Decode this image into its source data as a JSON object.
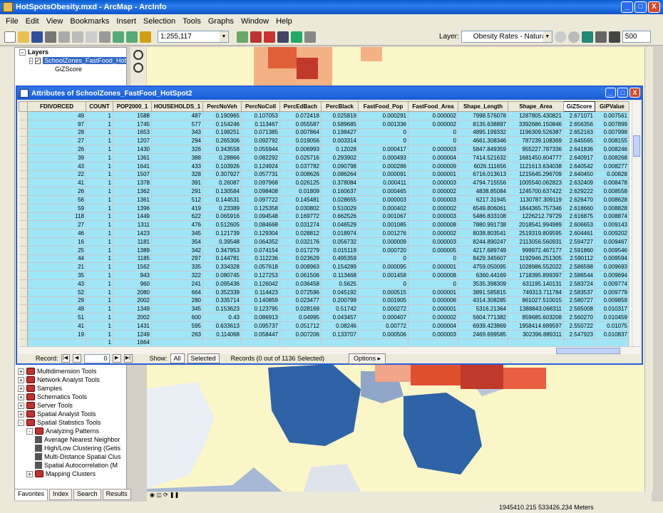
{
  "window": {
    "title": "HotSpotsObesity.mxd - ArcMap - ArcInfo",
    "min": "_",
    "max": "□",
    "close": "X"
  },
  "menu": [
    "File",
    "Edit",
    "View",
    "Bookmarks",
    "Insert",
    "Selection",
    "Tools",
    "Graphs",
    "Window",
    "Help"
  ],
  "toolbar": {
    "scale": "1:255,117",
    "layer_label": "Layer:",
    "layer_value": "Obesity Rates - Natural Breaks",
    "number": "500"
  },
  "toc": {
    "layers_title": "Layers",
    "layer_name": "SchoolZones_FastFood_HotSp",
    "field_name": "GiZScore",
    "tools": [
      {
        "label": "Multidimension Tools",
        "indent": 1,
        "kind": "toolbox"
      },
      {
        "label": "Network Analyst Tools",
        "indent": 1,
        "kind": "toolbox"
      },
      {
        "label": "Samples",
        "indent": 1,
        "kind": "toolbox"
      },
      {
        "label": "Schematics Tools",
        "indent": 1,
        "kind": "toolbox"
      },
      {
        "label": "Server Tools",
        "indent": 1,
        "kind": "toolbox"
      },
      {
        "label": "Spatial Analyst Tools",
        "indent": 1,
        "kind": "toolbox"
      },
      {
        "label": "Spatial Statistics Tools",
        "indent": 1,
        "kind": "toolbox"
      },
      {
        "label": "Analyzing Patterns",
        "indent": 2,
        "kind": "toolbox"
      },
      {
        "label": "Average Nearest Neighbor",
        "indent": 3,
        "kind": "tool"
      },
      {
        "label": "High/Low Clustering (Getis",
        "indent": 3,
        "kind": "tool"
      },
      {
        "label": "Multi-Distance Spatial Clus",
        "indent": 3,
        "kind": "tool"
      },
      {
        "label": "Spatial Autocorrelation (M",
        "indent": 3,
        "kind": "tool"
      },
      {
        "label": "Mapping Clusters",
        "indent": 2,
        "kind": "toolbox"
      }
    ],
    "tabs": [
      "Favorites",
      "Index",
      "Search",
      "Results"
    ]
  },
  "attributes": {
    "title": "Attributes of SchoolZones_FastFood_HotSpot2",
    "columns": [
      "FDIVORCED",
      "COUNT",
      "POP2000_1",
      "HOUSEHOLDS_1",
      "PercNoVeh",
      "PercNoColl",
      "PercEdBach",
      "PercBlack",
      "FastFood_Pop",
      "FastFood_Area",
      "Shape_Length",
      "Shape_Area",
      "GiZScore",
      "GiPValue"
    ],
    "rows": [
      [
        "49",
        "1",
        "1588",
        "487",
        "0.190965",
        "0.107053",
        "0.072418",
        "0.025819",
        "0.000291",
        "0.000002",
        "7998.576078",
        "1287805.430821",
        "2.671071",
        "0.007561"
      ],
      [
        "97",
        "1",
        "1745",
        "577",
        "0.154246",
        "0.113467",
        "0.055587",
        "0.589685",
        "0.001336",
        "0.000002",
        "8135.638897",
        "3392686.150846",
        "2.656356",
        "0.007899"
      ],
      [
        "28",
        "1",
        "1653",
        "343",
        "0.198251",
        "0.071385",
        "0.007864",
        "0.198427",
        "0",
        "0",
        "4895.199332",
        "1196309.526387",
        "2.652163",
        "0.007998"
      ],
      [
        "27",
        "1",
        "1207",
        "294",
        "0.265306",
        "0.092792",
        "0.019056",
        "0.003314",
        "0",
        "0",
        "4661.308346",
        "787239.108369",
        "2.645565",
        "0.008155"
      ],
      [
        "26",
        "1",
        "1430",
        "326",
        "0.343558",
        "0.055944",
        "0.006993",
        "0.12028",
        "0.000417",
        "0.000003",
        "5847.849359",
        "955227.787336",
        "2.641836",
        "0.008246"
      ],
      [
        "39",
        "1",
        "1361",
        "388",
        "0.28866",
        "0.082292",
        "0.025716",
        "0.293902",
        "0.000493",
        "0.000004",
        "7414.521632",
        "1681450.604777",
        "2.640917",
        "0.008268"
      ],
      [
        "43",
        "1",
        "1641",
        "433",
        "0.103926",
        "0.124924",
        "0.037782",
        "0.090798",
        "0.000286",
        "0.000009",
        "6026.111656",
        "1121613.634038",
        "2.640542",
        "0.008277"
      ],
      [
        "22",
        "1",
        "1507",
        "328",
        "0.307927",
        "0.057731",
        "0.008626",
        "0.086264",
        "0.000091",
        "0.000001",
        "6716.013613",
        "1215645.296709",
        "2.640450",
        "0.00828"
      ],
      [
        "41",
        "1",
        "1378",
        "391",
        "0.26087",
        "0.097968",
        "0.026125",
        "0.378084",
        "0.000411",
        "0.000003",
        "4794.715556",
        "1005540.062823",
        "2.632409",
        "0.008478"
      ],
      [
        "26",
        "1",
        "1362",
        "291",
        "0.130584",
        "0.098408",
        "0.01809",
        "0.160637",
        "0.000465",
        "0.000002",
        "4838.85084",
        "1245700.637422",
        "2.629222",
        "0.008558"
      ],
      [
        "56",
        "1",
        "1361",
        "512",
        "0.144531",
        "0.097722",
        "0.145481",
        "0.028655",
        "0.000003",
        "0.000003",
        "6217.31945",
        "1130787.309119",
        "2.626470",
        "0.008628"
      ],
      [
        "59",
        "1",
        "1396",
        "419",
        "0.23389",
        "0.125358",
        "0.030802",
        "0.510029",
        "0.000402",
        "0.000002",
        "6549.806061",
        "1844365.757346",
        "2.618660",
        "0.008828"
      ],
      [
        "118",
        "1",
        "1449",
        "622",
        "0.065916",
        "0.094548",
        "0.169772",
        "0.662526",
        "0.001067",
        "0.000003",
        "5486.833108",
        "1226212.79729",
        "2.616875",
        "0.008874"
      ],
      [
        "27",
        "1",
        "1311",
        "476",
        "0.512605",
        "0.084668",
        "0.031274",
        "0.046529",
        "0.001085",
        "0.000008",
        "7880.991738",
        "2018541.994989",
        "2.606653",
        "0.009143"
      ],
      [
        "46",
        "1",
        "1423",
        "345",
        "0.121739",
        "0.129304",
        "0.028812",
        "0.018974",
        "0.001276",
        "0.000002",
        "8038.803541",
        "2519319.809595",
        "2.604461",
        "0.009202"
      ],
      [
        "16",
        "1",
        "1181",
        "354",
        "0.39548",
        "0.064352",
        "0.032176",
        "0.056732",
        "0.000009",
        "0.000003",
        "8244.890247",
        "2113056.560931",
        "2.594727",
        "0.009467"
      ],
      [
        "25",
        "1",
        "1389",
        "342",
        "0.347953",
        "0.074154",
        "0.017279",
        "0.015119",
        "0.000720",
        "0.000005",
        "4217.689749",
        "999972.467177",
        "2.591860",
        "0.009546"
      ],
      [
        "44",
        "1",
        "1185",
        "297",
        "0.144781",
        "0.112236",
        "0.023629",
        "0.495359",
        "0",
        "0",
        "8429.345607",
        "1192946.251305",
        "2.590112",
        "0.009594"
      ],
      [
        "21",
        "1",
        "1562",
        "335",
        "0.334328",
        "0.057618",
        "0.008963",
        "0.154289",
        "0.000095",
        "0.000001",
        "4759.050095",
        "1028986.552022",
        "2.586598",
        "0.009693"
      ],
      [
        "35",
        "1",
        "943",
        "322",
        "0.080745",
        "0.127253",
        "0.061506",
        "0.113468",
        "0.001458",
        "0.000008",
        "6360.44169",
        "1718395.899397",
        "2.586544",
        "0.009694"
      ],
      [
        "43",
        "1",
        "960",
        "241",
        "0.095436",
        "0.126042",
        "0.036458",
        "0.5625",
        "0",
        "0",
        "3535.398309",
        "631195.140131",
        "2.583724",
        "0.009774"
      ],
      [
        "52",
        "1",
        "2080",
        "664",
        "0.352339",
        "0.114423",
        "0.072596",
        "0.045192",
        "0.000515",
        "0.000001",
        "3891.585815",
        "749313.711784",
        "2.583537",
        "0.009779"
      ],
      [
        "29",
        "1",
        "2002",
        "280",
        "0.335714",
        "0.140859",
        "0.023477",
        "0.200799",
        "0.001905",
        "0.000006",
        "4314.308285",
        "861027.510015",
        "2.580727",
        "0.009859"
      ],
      [
        "49",
        "1",
        "1349",
        "345",
        "0.153623",
        "0.123795",
        "0.028169",
        "0.51742",
        "0.000272",
        "0.000001",
        "5316.21364",
        "1388843.068311",
        "2.565008",
        "0.010317"
      ],
      [
        "51",
        "1",
        "2002",
        "600",
        "0.43",
        "0.086913",
        "0.04995",
        "0.043457",
        "0.000407",
        "0.000002",
        "5604.771382",
        "859685.603208",
        "2.560270",
        "0.010459"
      ],
      [
        "41",
        "1",
        "1431",
        "595",
        "0.633613",
        "0.095737",
        "0.051712",
        "0.08246",
        "0.00772",
        "0.000004",
        "6939.423869",
        "1958414.689597",
        "2.550722",
        "0.01075"
      ],
      [
        "19",
        "1",
        "1249",
        "263",
        "0.114068",
        "0.058447",
        "0.007206",
        "0.133707",
        "0.000506",
        "0.000003",
        "2469.699585",
        "302396.889311",
        "2.547923",
        "0.010837"
      ],
      [
        "",
        "1",
        "1664",
        "",
        "",
        "",
        "",
        "",
        "",
        "",
        "",
        "",
        "",
        ""
      ]
    ],
    "record": {
      "label": "Record:",
      "value": "0",
      "show_label": "Show:",
      "all": "All",
      "selected": "Selected",
      "summary": "Records (0 out of 1136 Selected)",
      "options": "Options"
    }
  },
  "status": {
    "coords": "1945410.215  533426.234 Meters"
  },
  "colors": {
    "selection": "#9fe6f7",
    "titlebar": "#0b5ad1",
    "map_bg": "#fbf6c7"
  }
}
